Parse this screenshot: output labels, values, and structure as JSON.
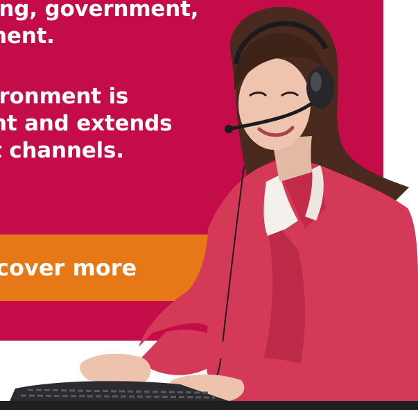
{
  "promo": {
    "lines_top": [
      "ing, government,",
      "nent."
    ],
    "lines_bottom": [
      "ironment is",
      "nt and extends",
      "t channels."
    ],
    "cta_label": "cover more"
  },
  "colors": {
    "panel": "#c40c48",
    "cta": "#e67817",
    "text": "#ffffff"
  },
  "photo": {
    "subject": "call-center-agent-with-headset-at-keyboard"
  }
}
